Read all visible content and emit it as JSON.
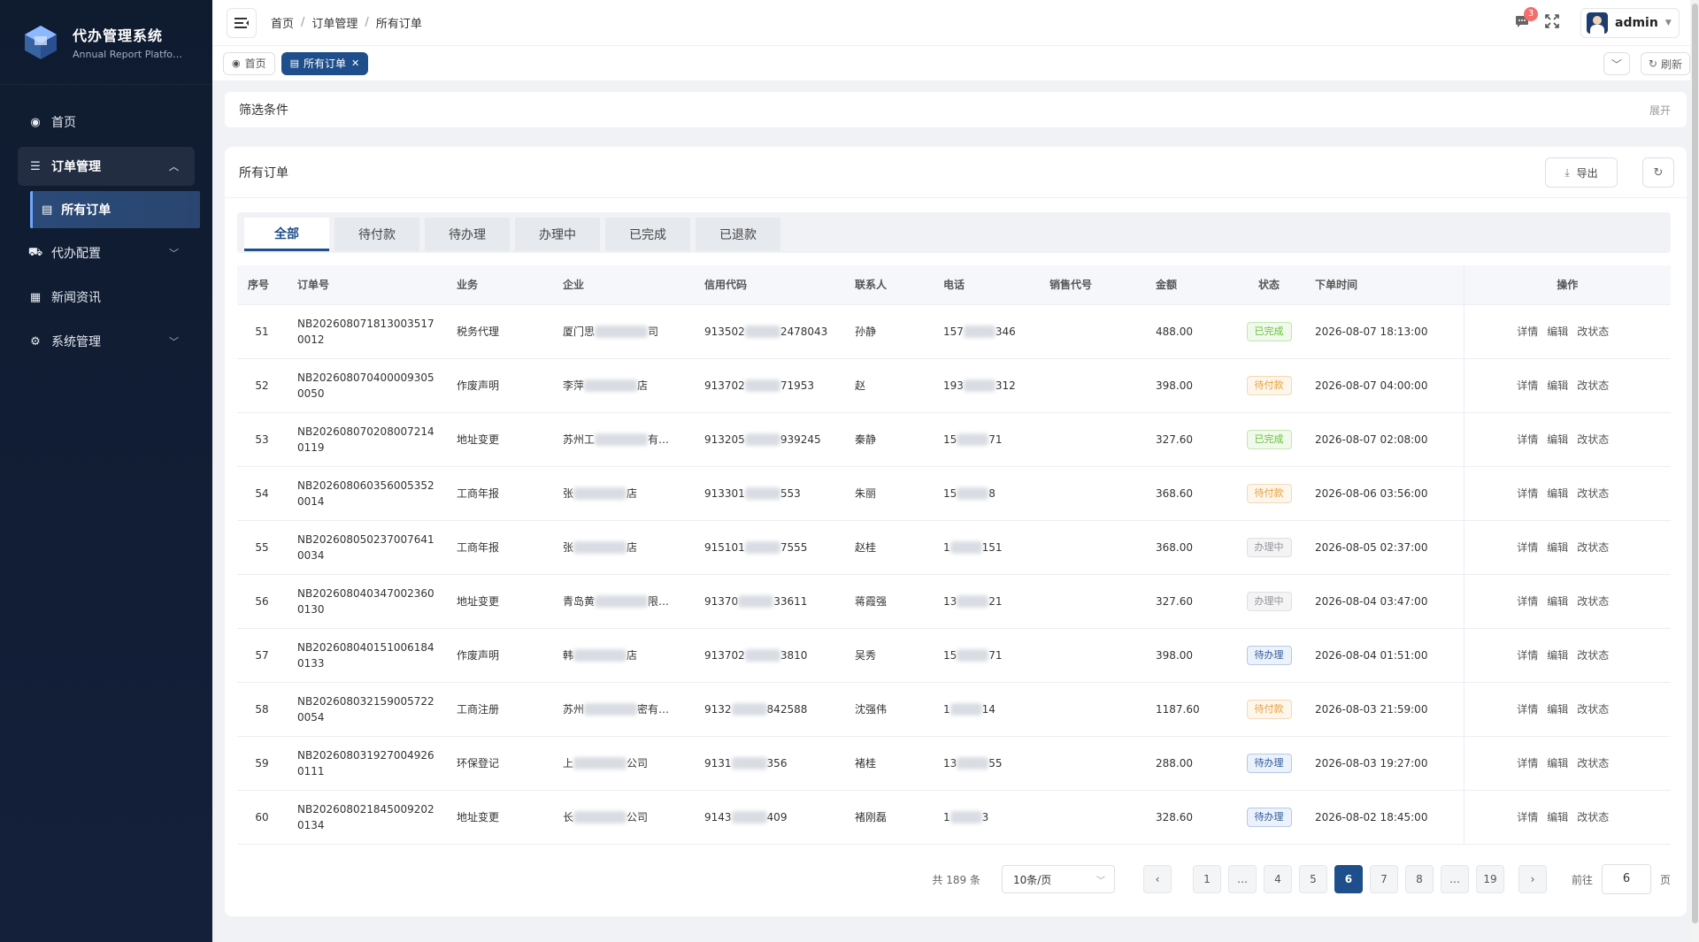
{
  "sidebar": {
    "title": "代办管理系统",
    "subtitle": "Annual Report Platfo…",
    "menu": [
      {
        "label": "首页"
      },
      {
        "label": "订单管理"
      },
      {
        "label": "所有订单"
      },
      {
        "label": "代办配置"
      },
      {
        "label": "新闻资讯"
      },
      {
        "label": "系统管理"
      }
    ]
  },
  "header": {
    "breadcrumb": [
      "首页",
      "订单管理",
      "所有订单"
    ],
    "notification_count": "3",
    "user": "admin"
  },
  "tags": {
    "home": "首页",
    "active": "所有订单",
    "refresh": "刷新"
  },
  "filter": {
    "title": "筛选条件",
    "expand": "展开"
  },
  "card": {
    "title": "所有订单",
    "export": "导出"
  },
  "status_tabs": [
    "全部",
    "待付款",
    "待办理",
    "办理中",
    "已完成",
    "已退款"
  ],
  "table": {
    "headers": [
      "序号",
      "订单号",
      "业务",
      "企业",
      "信用代码",
      "联系人",
      "电话",
      "销售代号",
      "金额",
      "状态",
      "下单时间",
      "操作"
    ],
    "rows": [
      {
        "no": "51",
        "order": "NB2026080718130035170012",
        "biz": "税务代理",
        "co_a": "厦门思",
        "co_b": "司",
        "code_a": "913502",
        "code_b": "2478043",
        "contact": "孙静",
        "tel_a": "157",
        "tel_b": "346",
        "amount": "488.00",
        "status": "已完成",
        "time": "2026-08-07 18:13:00"
      },
      {
        "no": "52",
        "order": "NB2026080704000093050050",
        "biz": "作废声明",
        "co_a": "李萍",
        "co_b": "店",
        "code_a": "913702",
        "code_b": "71953",
        "contact": "赵",
        "tel_a": "193",
        "tel_b": "312",
        "amount": "398.00",
        "status": "待付款",
        "time": "2026-08-07 04:00:00"
      },
      {
        "no": "53",
        "order": "NB2026080702080072140119",
        "biz": "地址变更",
        "co_a": "苏州工",
        "co_b": "有…",
        "code_a": "913205",
        "code_b": "939245",
        "contact": "秦静",
        "tel_a": "15",
        "tel_b": "71",
        "amount": "327.60",
        "status": "已完成",
        "time": "2026-08-07 02:08:00"
      },
      {
        "no": "54",
        "order": "NB2026080603560053520014",
        "biz": "工商年报",
        "co_a": "张",
        "co_b": "店",
        "code_a": "913301",
        "code_b": "553",
        "contact": "朱丽",
        "tel_a": "15",
        "tel_b": "8",
        "amount": "368.60",
        "status": "待付款",
        "time": "2026-08-06 03:56:00"
      },
      {
        "no": "55",
        "order": "NB2026080502370076410034",
        "biz": "工商年报",
        "co_a": "张",
        "co_b": "店",
        "code_a": "915101",
        "code_b": "7555",
        "contact": "赵桂",
        "tel_a": "1",
        "tel_b": "151",
        "amount": "368.00",
        "status": "办理中",
        "time": "2026-08-05 02:37:00"
      },
      {
        "no": "56",
        "order": "NB2026080403470023600130",
        "biz": "地址变更",
        "co_a": "青岛黄",
        "co_b": "限…",
        "code_a": "91370",
        "code_b": "33611",
        "contact": "蒋霞强",
        "tel_a": "13",
        "tel_b": "21",
        "amount": "327.60",
        "status": "办理中",
        "time": "2026-08-04 03:47:00"
      },
      {
        "no": "57",
        "order": "NB2026080401510061840133",
        "biz": "作废声明",
        "co_a": "韩",
        "co_b": "店",
        "code_a": "913702",
        "code_b": "3810",
        "contact": "吴秀",
        "tel_a": "15",
        "tel_b": "71",
        "amount": "398.00",
        "status": "待办理",
        "time": "2026-08-04 01:51:00"
      },
      {
        "no": "58",
        "order": "NB2026080321590057220054",
        "biz": "工商注册",
        "co_a": "苏州",
        "co_b": "密有…",
        "code_a": "9132",
        "code_b": "842588",
        "contact": "沈强伟",
        "tel_a": "1",
        "tel_b": "14",
        "amount": "1187.60",
        "status": "待付款",
        "time": "2026-08-03 21:59:00"
      },
      {
        "no": "59",
        "order": "NB2026080319270049260111",
        "biz": "环保登记",
        "co_a": "上",
        "co_b": "公司",
        "code_a": "9131",
        "code_b": "356",
        "contact": "褚桂",
        "tel_a": "13",
        "tel_b": "55",
        "amount": "288.00",
        "status": "待办理",
        "time": "2026-08-03 19:27:00"
      },
      {
        "no": "60",
        "order": "NB2026080218450092020134",
        "biz": "地址变更",
        "co_a": "长",
        "co_b": "公司",
        "code_a": "9143",
        "code_b": "409",
        "contact": "褚刚磊",
        "tel_a": "1",
        "tel_b": "3",
        "amount": "328.60",
        "status": "待办理",
        "time": "2026-08-02 18:45:00"
      }
    ],
    "ops": [
      "详情",
      "编辑",
      "改状态"
    ]
  },
  "pagination": {
    "total": "共 189 条",
    "page_size": "10条/页",
    "pages": [
      "1",
      "…",
      "4",
      "5",
      "6",
      "7",
      "8",
      "…",
      "19"
    ],
    "current": "6",
    "goto_label": "前往",
    "goto_value": "6",
    "unit": "页"
  },
  "colors": {
    "primary": "#1f4e8c",
    "sidebar": "#0f1b2f"
  }
}
